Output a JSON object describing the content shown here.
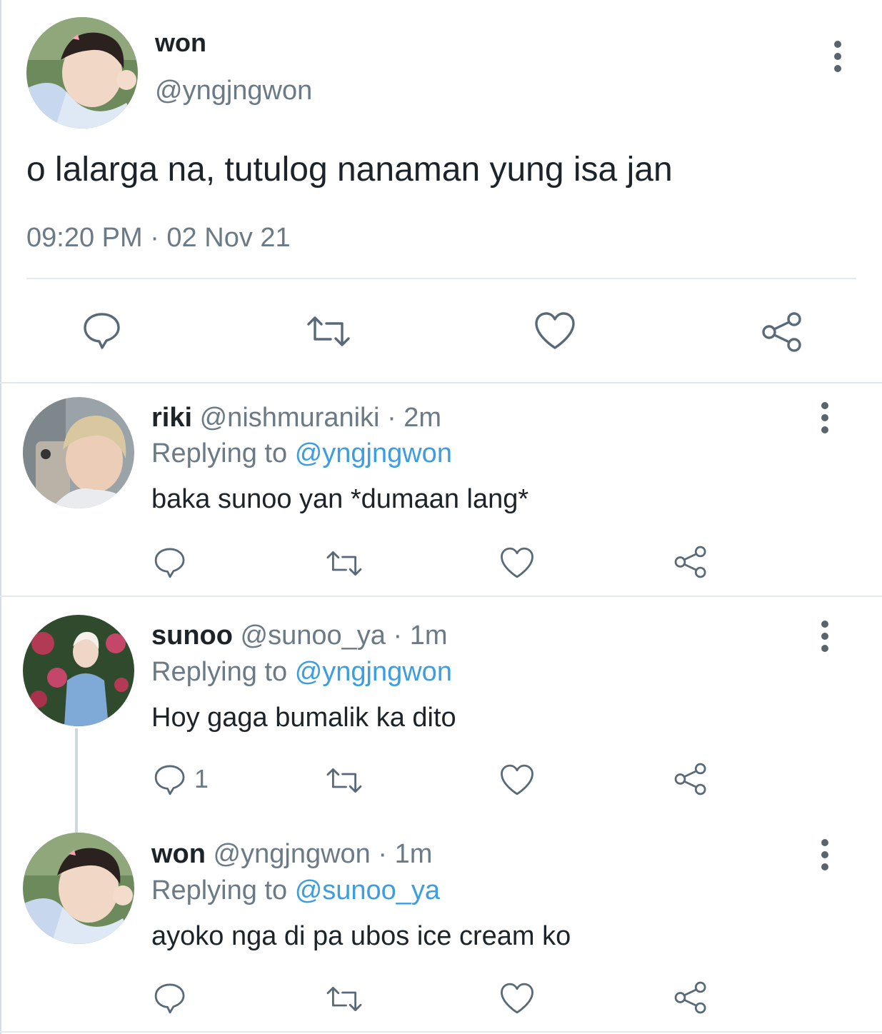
{
  "main_tweet": {
    "display_name": "won",
    "handle": "@yngjngwon",
    "text": "o lalarga na, tutulog nanaman yung isa jan",
    "timestamp": "09:20 PM · 02 Nov 21"
  },
  "replies": [
    {
      "display_name": "riki",
      "handle": "@nishmuraniki",
      "time": "· 2m",
      "replying_label": "Replying to",
      "replying_to": "@yngjngwon",
      "text": "baka sunoo yan *dumaan lang*",
      "reply_count": ""
    },
    {
      "display_name": "sunoo",
      "handle": "@sunoo_ya",
      "time": "· 1m",
      "replying_label": "Replying to",
      "replying_to": "@yngjngwon",
      "text": "Hoy gaga bumalik ka dito",
      "reply_count": "1"
    },
    {
      "display_name": "won",
      "handle": "@yngjngwon",
      "time": "· 1m",
      "replying_label": "Replying to",
      "replying_to": "@sunoo_ya",
      "text": "ayoko nga di pa ubos ice cream ko",
      "reply_count": ""
    }
  ],
  "action_icons": [
    "reply-icon",
    "retweet-icon",
    "like-icon",
    "share-icon"
  ],
  "colors": {
    "text": "#1c2329",
    "muted": "#6a7a86",
    "link": "#3c9de0",
    "icon": "#586a78",
    "divider": "#e4e9ed"
  }
}
